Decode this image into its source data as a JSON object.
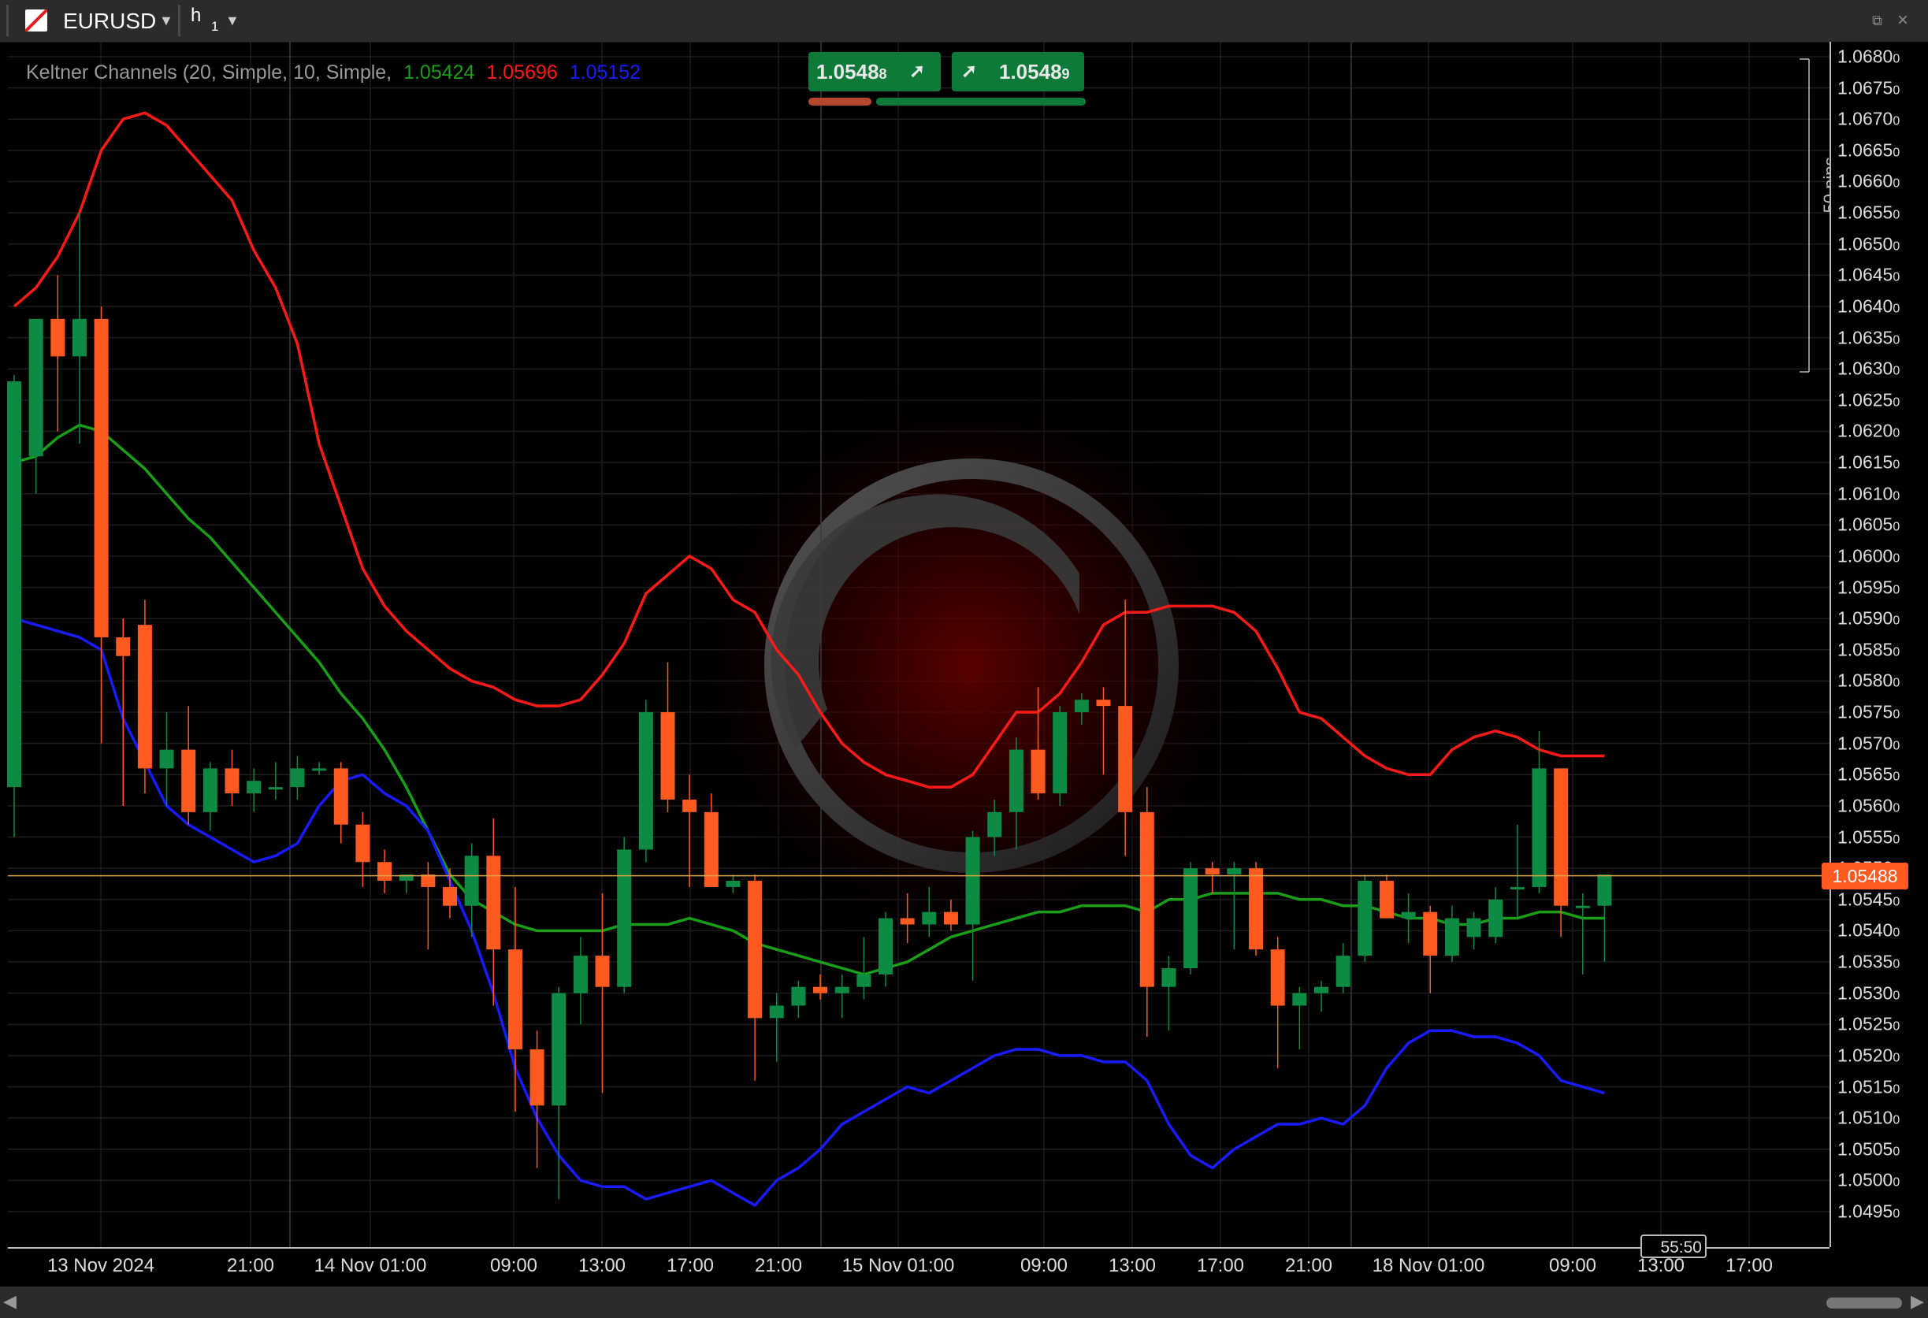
{
  "toolbar": {
    "symbol": "EURUSD",
    "symbol_caret": "▼",
    "timeframe_main": "h",
    "timeframe_sub": "1",
    "timeframe_caret": "▼",
    "detach_icon": "⧉",
    "close_icon": "×"
  },
  "indicator": {
    "label": "Keltner Channels (20, Simple, 10, Simple,",
    "middle_value": "1.05424",
    "upper_value": "1.05696",
    "lower_value": "1.05152",
    "middle_color": "#1a9e1a",
    "upper_color": "#ff1a1a",
    "lower_color": "#1a1aff"
  },
  "quick_trade": {
    "sell_price_main": "1.0548",
    "sell_price_pip": "8",
    "buy_price_main": "1.0548",
    "buy_price_pip": "9",
    "arrow": "➚",
    "sell_bar_color": "#b5482c",
    "buy_bar_color": "#0d7a3a"
  },
  "ruler": {
    "label": "50 pips"
  },
  "current_price": {
    "label": "1.05488",
    "value": 1.05488,
    "color": "#ff5a1f"
  },
  "countdown": {
    "label": "55:50"
  },
  "chart_data": {
    "type": "candlestick",
    "symbol": "EURUSD",
    "timeframe": "h1",
    "ylim": [
      1.0492,
      1.0683
    ],
    "y_ticks": [
      "1.06800",
      "1.06750",
      "1.06700",
      "1.06650",
      "1.06600",
      "1.06550",
      "1.06500",
      "1.06450",
      "1.06400",
      "1.06350",
      "1.06300",
      "1.06250",
      "1.06200",
      "1.06150",
      "1.06100",
      "1.06050",
      "1.06000",
      "1.05950",
      "1.05900",
      "1.05850",
      "1.05800",
      "1.05750",
      "1.05700",
      "1.05650",
      "1.05600",
      "1.05550",
      "1.05500",
      "1.05450",
      "1.05400",
      "1.05350",
      "1.05300",
      "1.05250",
      "1.05200",
      "1.05150",
      "1.05100",
      "1.05050",
      "1.05000",
      "1.04950"
    ],
    "x_ticks": [
      "13 Nov 2024",
      "21:00",
      "14 Nov 01:00",
      "09:00",
      "13:00",
      "17:00",
      "21:00",
      "15 Nov 01:00",
      "09:00",
      "13:00",
      "17:00",
      "21:00",
      "18 Nov 01:00",
      "09:00",
      "13:00",
      "17:00"
    ],
    "candles": [
      {
        "o": 1.0563,
        "h": 1.0629,
        "l": 1.0555,
        "c": 1.0628
      },
      {
        "o": 1.0616,
        "h": 1.0637,
        "l": 1.061,
        "c": 1.0638
      },
      {
        "o": 1.0638,
        "h": 1.0645,
        "l": 1.062,
        "c": 1.0632
      },
      {
        "o": 1.0632,
        "h": 1.0655,
        "l": 1.0618,
        "c": 1.0638
      },
      {
        "o": 1.0638,
        "h": 1.064,
        "l": 1.057,
        "c": 1.0587
      },
      {
        "o": 1.0587,
        "h": 1.059,
        "l": 1.056,
        "c": 1.0584
      },
      {
        "o": 1.0589,
        "h": 1.0593,
        "l": 1.0562,
        "c": 1.0566
      },
      {
        "o": 1.0566,
        "h": 1.0575,
        "l": 1.056,
        "c": 1.0569
      },
      {
        "o": 1.0569,
        "h": 1.0576,
        "l": 1.0557,
        "c": 1.0559
      },
      {
        "o": 1.0559,
        "h": 1.0567,
        "l": 1.0556,
        "c": 1.0566
      },
      {
        "o": 1.0566,
        "h": 1.0569,
        "l": 1.056,
        "c": 1.0562
      },
      {
        "o": 1.0562,
        "h": 1.0566,
        "l": 1.0559,
        "c": 1.0564
      },
      {
        "o": 1.0563,
        "h": 1.0567,
        "l": 1.0561,
        "c": 1.0563
      },
      {
        "o": 1.0563,
        "h": 1.0568,
        "l": 1.0561,
        "c": 1.0566
      },
      {
        "o": 1.0566,
        "h": 1.0567,
        "l": 1.0565,
        "c": 1.0566
      },
      {
        "o": 1.0566,
        "h": 1.0567,
        "l": 1.0554,
        "c": 1.0557
      },
      {
        "o": 1.0557,
        "h": 1.0559,
        "l": 1.0547,
        "c": 1.0551
      },
      {
        "o": 1.0551,
        "h": 1.0553,
        "l": 1.0546,
        "c": 1.0548
      },
      {
        "o": 1.0548,
        "h": 1.0549,
        "l": 1.0546,
        "c": 1.0549
      },
      {
        "o": 1.0549,
        "h": 1.0551,
        "l": 1.0537,
        "c": 1.0547
      },
      {
        "o": 1.0547,
        "h": 1.055,
        "l": 1.0542,
        "c": 1.0544
      },
      {
        "o": 1.0544,
        "h": 1.0554,
        "l": 1.0539,
        "c": 1.0552
      },
      {
        "o": 1.0552,
        "h": 1.0558,
        "l": 1.0528,
        "c": 1.0537
      },
      {
        "o": 1.0537,
        "h": 1.0547,
        "l": 1.0511,
        "c": 1.0521
      },
      {
        "o": 1.0521,
        "h": 1.0524,
        "l": 1.0502,
        "c": 1.0512
      },
      {
        "o": 1.0512,
        "h": 1.0531,
        "l": 1.0497,
        "c": 1.053
      },
      {
        "o": 1.053,
        "h": 1.0539,
        "l": 1.0525,
        "c": 1.0536
      },
      {
        "o": 1.0536,
        "h": 1.0546,
        "l": 1.0514,
        "c": 1.0531
      },
      {
        "o": 1.0531,
        "h": 1.0555,
        "l": 1.053,
        "c": 1.0553
      },
      {
        "o": 1.0553,
        "h": 1.0577,
        "l": 1.0551,
        "c": 1.0575
      },
      {
        "o": 1.0575,
        "h": 1.0583,
        "l": 1.0559,
        "c": 1.0561
      },
      {
        "o": 1.0561,
        "h": 1.0565,
        "l": 1.0547,
        "c": 1.0559
      },
      {
        "o": 1.0559,
        "h": 1.0562,
        "l": 1.0547,
        "c": 1.0547
      },
      {
        "o": 1.0547,
        "h": 1.0549,
        "l": 1.0546,
        "c": 1.0548
      },
      {
        "o": 1.0548,
        "h": 1.0549,
        "l": 1.0516,
        "c": 1.0526
      },
      {
        "o": 1.0526,
        "h": 1.053,
        "l": 1.0519,
        "c": 1.0528
      },
      {
        "o": 1.0528,
        "h": 1.0532,
        "l": 1.0526,
        "c": 1.0531
      },
      {
        "o": 1.0531,
        "h": 1.0533,
        "l": 1.0529,
        "c": 1.053
      },
      {
        "o": 1.053,
        "h": 1.0533,
        "l": 1.0526,
        "c": 1.0531
      },
      {
        "o": 1.0531,
        "h": 1.0539,
        "l": 1.0529,
        "c": 1.0533
      },
      {
        "o": 1.0533,
        "h": 1.0543,
        "l": 1.0531,
        "c": 1.0542
      },
      {
        "o": 1.0542,
        "h": 1.0546,
        "l": 1.0538,
        "c": 1.0541
      },
      {
        "o": 1.0541,
        "h": 1.0547,
        "l": 1.0539,
        "c": 1.0543
      },
      {
        "o": 1.0543,
        "h": 1.0545,
        "l": 1.054,
        "c": 1.0541
      },
      {
        "o": 1.0541,
        "h": 1.0556,
        "l": 1.0532,
        "c": 1.0555
      },
      {
        "o": 1.0555,
        "h": 1.0561,
        "l": 1.0552,
        "c": 1.0559
      },
      {
        "o": 1.0559,
        "h": 1.0571,
        "l": 1.0553,
        "c": 1.0569
      },
      {
        "o": 1.0569,
        "h": 1.0579,
        "l": 1.0561,
        "c": 1.0562
      },
      {
        "o": 1.0562,
        "h": 1.0576,
        "l": 1.056,
        "c": 1.0575
      },
      {
        "o": 1.0575,
        "h": 1.0578,
        "l": 1.0573,
        "c": 1.0577
      },
      {
        "o": 1.0577,
        "h": 1.0579,
        "l": 1.0565,
        "c": 1.0576
      },
      {
        "o": 1.0576,
        "h": 1.0593,
        "l": 1.0552,
        "c": 1.0559
      },
      {
        "o": 1.0559,
        "h": 1.0563,
        "l": 1.0523,
        "c": 1.0531
      },
      {
        "o": 1.0531,
        "h": 1.0536,
        "l": 1.0524,
        "c": 1.0534
      },
      {
        "o": 1.0534,
        "h": 1.0551,
        "l": 1.0533,
        "c": 1.055
      },
      {
        "o": 1.055,
        "h": 1.0551,
        "l": 1.0546,
        "c": 1.0549
      },
      {
        "o": 1.0549,
        "h": 1.0551,
        "l": 1.0537,
        "c": 1.055
      },
      {
        "o": 1.055,
        "h": 1.0551,
        "l": 1.0536,
        "c": 1.0537
      },
      {
        "o": 1.0537,
        "h": 1.0539,
        "l": 1.0518,
        "c": 1.0528
      },
      {
        "o": 1.0528,
        "h": 1.0531,
        "l": 1.0521,
        "c": 1.053
      },
      {
        "o": 1.053,
        "h": 1.0532,
        "l": 1.0527,
        "c": 1.0531
      },
      {
        "o": 1.0531,
        "h": 1.0538,
        "l": 1.053,
        "c": 1.0536
      },
      {
        "o": 1.0536,
        "h": 1.0549,
        "l": 1.0535,
        "c": 1.0548
      },
      {
        "o": 1.0548,
        "h": 1.0549,
        "l": 1.0542,
        "c": 1.0542
      },
      {
        "o": 1.0542,
        "h": 1.0546,
        "l": 1.0538,
        "c": 1.0543
      },
      {
        "o": 1.0543,
        "h": 1.0544,
        "l": 1.053,
        "c": 1.0536
      },
      {
        "o": 1.0536,
        "h": 1.0544,
        "l": 1.0535,
        "c": 1.0542
      },
      {
        "o": 1.0539,
        "h": 1.0543,
        "l": 1.0537,
        "c": 1.0542
      },
      {
        "o": 1.0539,
        "h": 1.0547,
        "l": 1.0538,
        "c": 1.0545
      },
      {
        "o": 1.0547,
        "h": 1.0557,
        "l": 1.0542,
        "c": 1.0547
      },
      {
        "o": 1.0547,
        "h": 1.0572,
        "l": 1.0546,
        "c": 1.0566
      },
      {
        "o": 1.0566,
        "h": 1.0566,
        "l": 1.0539,
        "c": 1.0544
      },
      {
        "o": 1.0544,
        "h": 1.0546,
        "l": 1.0533,
        "c": 1.0544
      },
      {
        "o": 1.0544,
        "h": 1.0548,
        "l": 1.0535,
        "c": 1.0549
      }
    ],
    "series": [
      {
        "name": "Upper",
        "color": "#ff1a1a",
        "values": [
          1.064,
          1.0643,
          1.0648,
          1.0655,
          1.0665,
          1.067,
          1.0671,
          1.0669,
          1.0665,
          1.0661,
          1.0657,
          1.0649,
          1.0643,
          1.0634,
          1.0618,
          1.0608,
          1.0598,
          1.0592,
          1.0588,
          1.0585,
          1.0582,
          1.058,
          1.0579,
          1.0577,
          1.0576,
          1.0576,
          1.0577,
          1.0581,
          1.0586,
          1.0594,
          1.0597,
          1.06,
          1.0598,
          1.0593,
          1.0591,
          1.0585,
          1.0581,
          1.0575,
          1.057,
          1.0567,
          1.0565,
          1.0564,
          1.0563,
          1.0563,
          1.0565,
          1.057,
          1.0575,
          1.0575,
          1.0578,
          1.0583,
          1.0589,
          1.0591,
          1.0591,
          1.0592,
          1.0592,
          1.0592,
          1.0591,
          1.0588,
          1.0582,
          1.0575,
          1.0574,
          1.0571,
          1.0568,
          1.0566,
          1.0565,
          1.0565,
          1.0569,
          1.0571,
          1.0572,
          1.0571,
          1.0569,
          1.0568,
          1.0568,
          1.0568
        ]
      },
      {
        "name": "Middle",
        "color": "#1a9e1a",
        "values": [
          1.0615,
          1.0616,
          1.0619,
          1.0621,
          1.062,
          1.0617,
          1.0614,
          1.061,
          1.0606,
          1.0603,
          1.0599,
          1.0595,
          1.0591,
          1.0587,
          1.0583,
          1.0578,
          1.0574,
          1.0569,
          1.0563,
          1.0556,
          1.0549,
          1.0545,
          1.0543,
          1.0541,
          1.054,
          1.054,
          1.054,
          1.054,
          1.0541,
          1.0541,
          1.0541,
          1.0542,
          1.0541,
          1.054,
          1.0538,
          1.0537,
          1.0536,
          1.0535,
          1.0534,
          1.0533,
          1.0534,
          1.0535,
          1.0537,
          1.0539,
          1.054,
          1.0541,
          1.0542,
          1.0543,
          1.0543,
          1.0544,
          1.0544,
          1.0544,
          1.0543,
          1.0545,
          1.0545,
          1.0546,
          1.0546,
          1.0546,
          1.0546,
          1.0545,
          1.0545,
          1.0544,
          1.0544,
          1.0543,
          1.0542,
          1.0542,
          1.0541,
          1.0541,
          1.0542,
          1.0542,
          1.0543,
          1.0543,
          1.0542,
          1.0542
        ]
      },
      {
        "name": "Lower",
        "color": "#1a1aff",
        "values": [
          1.059,
          1.0589,
          1.0588,
          1.0587,
          1.0585,
          1.0574,
          1.0567,
          1.056,
          1.0557,
          1.0555,
          1.0553,
          1.0551,
          1.0552,
          1.0554,
          1.056,
          1.0564,
          1.0565,
          1.0562,
          1.056,
          1.0556,
          1.0548,
          1.054,
          1.053,
          1.0518,
          1.051,
          1.0504,
          1.05,
          1.0499,
          1.0499,
          1.0497,
          1.0498,
          1.0499,
          1.05,
          1.0498,
          1.0496,
          1.05,
          1.0502,
          1.0505,
          1.0509,
          1.0511,
          1.0513,
          1.0515,
          1.0514,
          1.0516,
          1.0518,
          1.052,
          1.0521,
          1.0521,
          1.052,
          1.052,
          1.0519,
          1.0519,
          1.0516,
          1.0509,
          1.0504,
          1.0502,
          1.0505,
          1.0507,
          1.0509,
          1.0509,
          1.051,
          1.0509,
          1.0512,
          1.0518,
          1.0522,
          1.0524,
          1.0524,
          1.0523,
          1.0523,
          1.0522,
          1.052,
          1.0516,
          1.0515,
          1.0514
        ]
      }
    ],
    "grid": true,
    "legend": "top-left"
  }
}
